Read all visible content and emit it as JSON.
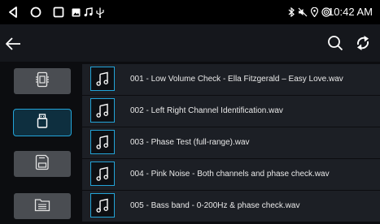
{
  "status_bar": {
    "time": "10:42 AM",
    "left_icons": [
      "back-triangle-icon",
      "home-circle-icon",
      "recents-square-icon",
      "image-icon",
      "music-note-icon",
      "usb-icon"
    ],
    "right_icons": [
      "bluetooth-icon",
      "mute-icon",
      "location-icon",
      "wifi-hotspot-icon"
    ]
  },
  "toolbar": {
    "back_icon": "arrow-left-icon",
    "search_icon": "search-icon",
    "refresh_icon": "refresh-icon"
  },
  "sidebar": {
    "items": [
      {
        "icon": "sd-card-icon",
        "active": false
      },
      {
        "icon": "usb-drive-icon",
        "active": true
      },
      {
        "icon": "storage-icon",
        "active": false
      },
      {
        "icon": "folder-list-icon",
        "active": false
      }
    ]
  },
  "files": [
    {
      "name": "001 - Low Volume Check - Ella Fitzgerald – Easy Love.wav"
    },
    {
      "name": "002 - Left  Right Channel Identification.wav"
    },
    {
      "name": "003 - Phase Test (full-range).wav"
    },
    {
      "name": "004 - Pink Noise - Both channels and phase check.wav"
    },
    {
      "name": "005 - Bass band - 0-200Hz & phase check.wav"
    }
  ],
  "colors": {
    "accent": "#23a4d8",
    "row_bg": "#1c1f25",
    "toolbar_bg": "#15171c",
    "sidebar_btn": "#4a4d52"
  }
}
